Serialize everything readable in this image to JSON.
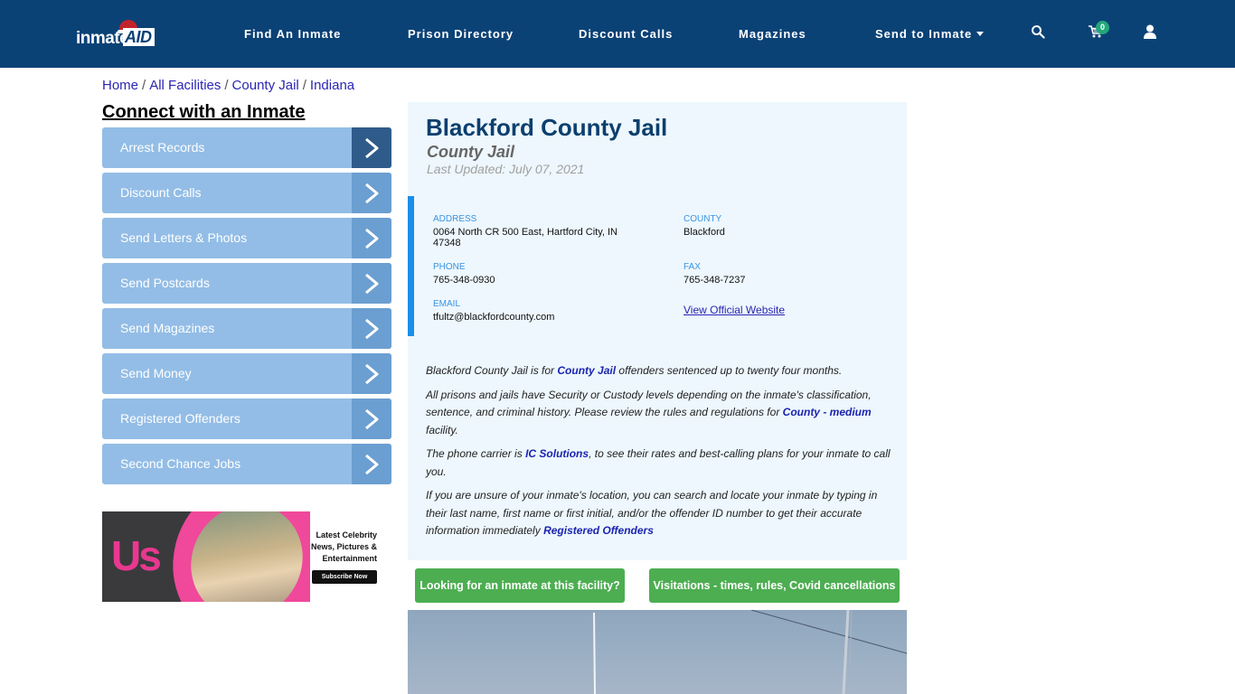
{
  "header": {
    "logo": {
      "part1": "inmate",
      "part2": "AID"
    },
    "nav": [
      {
        "label": "Find An Inmate"
      },
      {
        "label": "Prison Directory"
      },
      {
        "label": "Discount Calls"
      },
      {
        "label": "Magazines"
      },
      {
        "label": "Send to Inmate",
        "has_dropdown": true
      }
    ],
    "icons": {
      "search": "search-icon",
      "cart": "cart-icon",
      "user": "user-icon"
    },
    "cart_count": "0"
  },
  "breadcrumb": [
    {
      "label": "Home"
    },
    {
      "label": "All Facilities"
    },
    {
      "label": "County Jail"
    },
    {
      "label": "Indiana"
    }
  ],
  "breadcrumb_separator": "/",
  "sidebar": {
    "title": "Connect with an Inmate",
    "items": [
      {
        "label": "Arrest Records",
        "active": true
      },
      {
        "label": "Discount Calls"
      },
      {
        "label": "Send Letters & Photos"
      },
      {
        "label": "Send Postcards"
      },
      {
        "label": "Send Magazines"
      },
      {
        "label": "Send Money"
      },
      {
        "label": "Registered Offenders"
      },
      {
        "label": "Second Chance Jobs"
      }
    ],
    "ad": {
      "brand": "Us",
      "tagline_lines": [
        "Latest Celebrity",
        "News, Pictures &",
        "Entertainment"
      ],
      "cta": "Subscribe Now"
    }
  },
  "facility": {
    "name": "Blackford County Jail",
    "type": "County Jail",
    "last_updated": "Last Updated: July 07, 2021",
    "address_label": "ADDRESS",
    "address": "0064 North CR 500 East, Hartford City, IN 47348",
    "county_label": "COUNTY",
    "county": "Blackford",
    "phone_label": "PHONE",
    "phone": "765-348-0930",
    "fax_label": "FAX",
    "fax": "765-348-7237",
    "email_label": "EMAIL",
    "email": "tfultz@blackfordcounty.com",
    "website_link": "View Official Website"
  },
  "description": {
    "p1_pre": "Blackford County Jail is for ",
    "p1_link": "County Jail",
    "p1_post": " offenders sentenced up to twenty four months.",
    "p2_pre": "All prisons and jails have Security or Custody levels depending on the inmate's classification, sentence, and criminal history. Please review the rules and regulations for ",
    "p2_link": "County - medium",
    "p2_post": " facility.",
    "p3_pre": "The phone carrier is ",
    "p3_link": "IC Solutions",
    "p3_post": ", to see their rates and best-calling plans for your inmate to call you.",
    "p4_pre": "If you are unsure of your inmate's location, you can search and locate your inmate by typing in their last name, first name or first initial, and/or the offender ID number to get their accurate information immediately ",
    "p4_link": "Registered Offenders"
  },
  "actions": {
    "find_inmate": "Looking for an inmate at this facility?",
    "visitations": "Visitations - times, rules, Covid cancellations"
  },
  "colors": {
    "navbar": "#0b4276",
    "sidebar_item": "#93bde6",
    "sidebar_arrow": "#6b9fd1",
    "sidebar_arrow_active": "#2f5b8a",
    "panel_bg": "#edf7fd",
    "title": "#0c3f6e",
    "accent_bar": "#1a8fe8",
    "button_green": "#4cae51",
    "cart_badge": "#23a77b"
  }
}
